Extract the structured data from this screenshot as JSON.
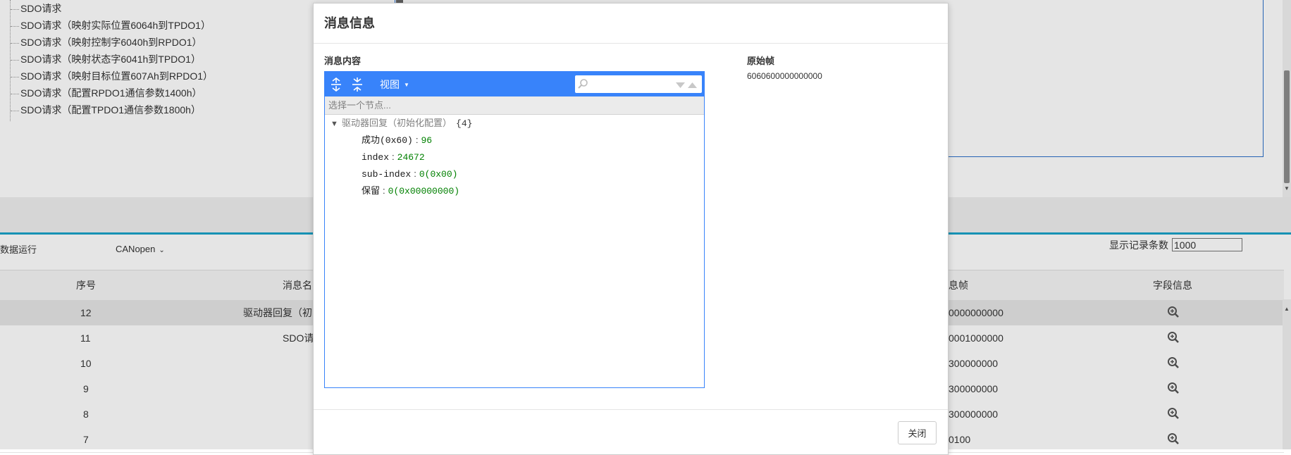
{
  "background": {
    "tree_items": [
      "SDO请求",
      "SDO请求（映射实际位置6064h到TPDO1）",
      "SDO请求（映射控制字6040h到RPDO1）",
      "SDO请求（映射状态字6041h到TPDO1）",
      "SDO请求（映射目标位置607Ah到RPDO1）",
      "SDO请求（配置RPDO1通信参数1400h）",
      "SDO请求（配置TPDO1通信参数1800h）"
    ],
    "toolbar": {
      "mode_label": "数据运行",
      "protocol": "CANopen",
      "count_label": "显示记录条数",
      "count_value": "1000"
    },
    "table": {
      "headers": {
        "index": "序号",
        "name": "消息名",
        "frame": "息帧",
        "fields": "字段信息"
      },
      "rows": [
        {
          "index": "12",
          "name": "驱动器回复（初",
          "frame": "0000000000"
        },
        {
          "index": "11",
          "name": "SDO请",
          "frame": "0001000000"
        },
        {
          "index": "10",
          "name": "",
          "frame": "300000000"
        },
        {
          "index": "9",
          "name": "",
          "frame": "300000000"
        },
        {
          "index": "8",
          "name": "",
          "frame": "300000000"
        },
        {
          "index": "7",
          "name": "",
          "frame": "0100"
        }
      ]
    }
  },
  "modal": {
    "title": "消息信息",
    "content_label": "消息内容",
    "raw_label": "原始帧",
    "raw_value": "6060600000000000",
    "viewer": {
      "view_label": "视图",
      "nav_placeholder": "选择一个节点...",
      "root": {
        "name": "驱动器回复（初始化配置）",
        "count": "{4}"
      },
      "fields": [
        {
          "key": "成功(0x60)",
          "value": "96"
        },
        {
          "key": "index",
          "value": "24672"
        },
        {
          "key": "sub-index",
          "value": "0(0x00)"
        },
        {
          "key": "保留",
          "value": "0(0x00000000)"
        }
      ]
    },
    "close_label": "关闭"
  },
  "colors": {
    "accent": "#3883fa",
    "value_green": "#008000",
    "band_line": "#1aa3c9"
  }
}
